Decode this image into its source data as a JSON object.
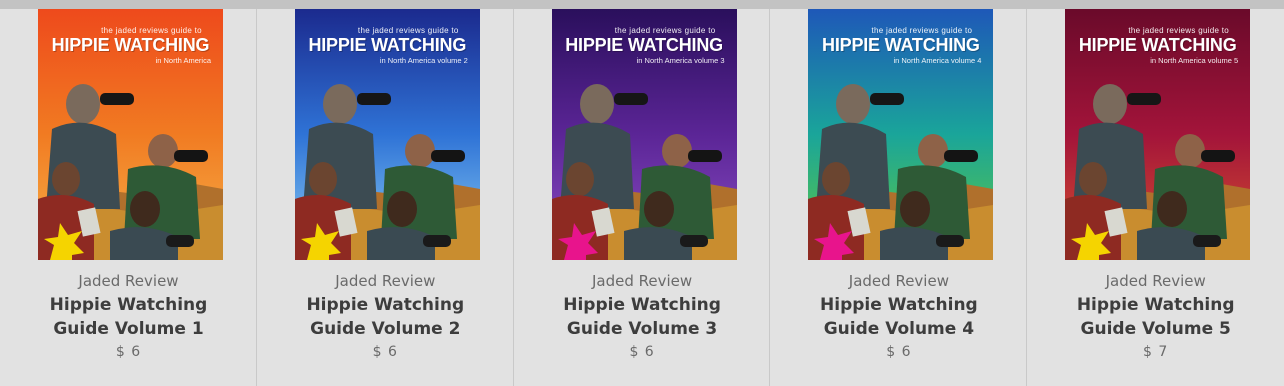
{
  "products": [
    {
      "vendor": "Jaded Review",
      "title": "Hippie Watching Guide Volume 1",
      "price": "$ 6",
      "cover": {
        "kicker": "the jaded reviews guide to",
        "title": "HIPPIE WATCHING",
        "subtitle": "in North America",
        "sky_top": "#ee4a1c",
        "sky_mid": "#f17b22",
        "sky_bottom": "#f6b34a",
        "badge_color": "#f5d400"
      }
    },
    {
      "vendor": "Jaded Review",
      "title": "Hippie Watching Guide Volume 2",
      "price": "$ 6",
      "cover": {
        "kicker": "the jaded reviews guide to",
        "title": "HIPPIE WATCHING",
        "subtitle": "in North America volume 2",
        "sky_top": "#1b2a8e",
        "sky_mid": "#2f73d6",
        "sky_bottom": "#8ed0f5",
        "badge_color": "#f5d400"
      }
    },
    {
      "vendor": "Jaded Review",
      "title": "Hippie Watching Guide Volume 3",
      "price": "$ 6",
      "cover": {
        "kicker": "the jaded reviews guide to",
        "title": "HIPPIE WATCHING",
        "subtitle": "in North America volume 3",
        "sky_top": "#2a0f5c",
        "sky_mid": "#5b2596",
        "sky_bottom": "#8c4fc6",
        "badge_color": "#e8148c"
      }
    },
    {
      "vendor": "Jaded Review",
      "title": "Hippie Watching Guide Volume 4",
      "price": "$ 6",
      "cover": {
        "kicker": "the jaded reviews guide to",
        "title": "HIPPIE WATCHING",
        "subtitle": "in North America volume 4",
        "sky_top": "#1e58b8",
        "sky_mid": "#1aa59a",
        "sky_bottom": "#62c93c",
        "badge_color": "#e8148c"
      }
    },
    {
      "vendor": "Jaded Review",
      "title": "Hippie Watching Guide Volume 5",
      "price": "$ 7",
      "cover": {
        "kicker": "the jaded reviews guide to",
        "title": "HIPPIE WATCHING",
        "subtitle": "in North America volume 5",
        "sky_top": "#6a0a2a",
        "sky_mid": "#a3143a",
        "sky_bottom": "#d8542e",
        "badge_color": "#f5d400"
      }
    }
  ]
}
